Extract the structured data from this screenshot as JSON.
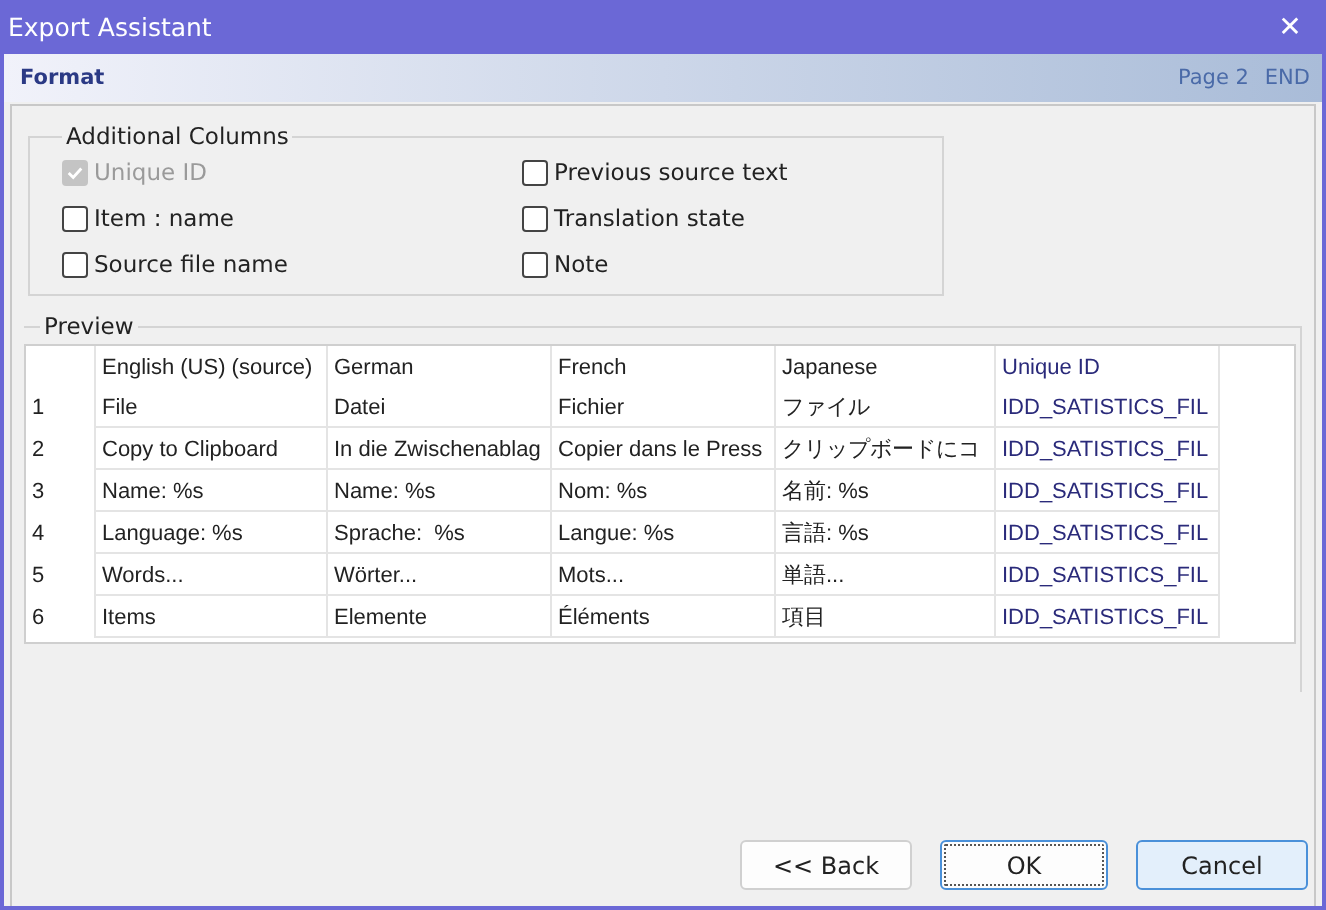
{
  "window": {
    "title": "Export Assistant",
    "close": "✕"
  },
  "header": {
    "title": "Format",
    "page": "Page 2",
    "end": "END"
  },
  "columns_group": {
    "title": "Additional Columns",
    "options": [
      {
        "label": "Unique ID",
        "checked": true,
        "disabled": true
      },
      {
        "label": "Item : name",
        "checked": false,
        "disabled": false
      },
      {
        "label": "Source file name",
        "checked": false,
        "disabled": false
      },
      {
        "label": "Previous source text",
        "checked": false,
        "disabled": false
      },
      {
        "label": "Translation state",
        "checked": false,
        "disabled": false
      },
      {
        "label": "Note",
        "checked": false,
        "disabled": false
      }
    ]
  },
  "preview": {
    "title": "Preview",
    "columns": [
      "English (US) (source)",
      "German",
      "French",
      "Japanese",
      "Unique ID"
    ],
    "rows": [
      {
        "number": "1",
        "cells": [
          "File",
          "Datei",
          "Fichier",
          "ファイル",
          "IDD_SATISTICS_FIL"
        ]
      },
      {
        "number": "2",
        "cells": [
          "Copy to Clipboard",
          "In die Zwischenablag",
          "Copier dans le Press",
          "クリップボードにコ",
          "IDD_SATISTICS_FIL"
        ]
      },
      {
        "number": "3",
        "cells": [
          "Name: %s",
          "Name: %s",
          "Nom: %s",
          "名前: %s",
          "IDD_SATISTICS_FIL"
        ]
      },
      {
        "number": "4",
        "cells": [
          "Language: %s",
          "Sprache:  %s",
          "Langue: %s",
          "言語: %s",
          "IDD_SATISTICS_FIL"
        ]
      },
      {
        "number": "5",
        "cells": [
          "Words...",
          "Wörter...",
          "Mots...",
          "単語...",
          "IDD_SATISTICS_FIL"
        ]
      },
      {
        "number": "6",
        "cells": [
          "Items",
          "Elemente",
          "Éléments",
          "項目",
          "IDD_SATISTICS_FIL"
        ]
      }
    ]
  },
  "buttons": [
    {
      "label": "<< Back",
      "kind": "normal"
    },
    {
      "label": "OK",
      "kind": "default"
    },
    {
      "label": "Cancel",
      "kind": "focused"
    }
  ]
}
